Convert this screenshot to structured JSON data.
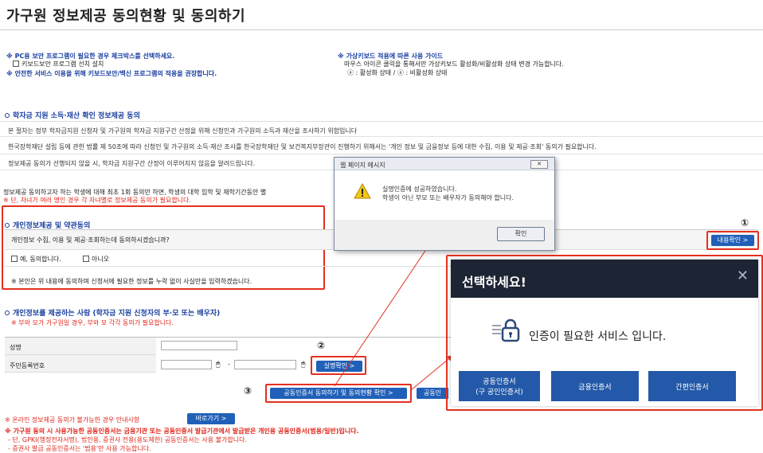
{
  "page_title": "가구원 정보제공 동의현황 및 동의하기",
  "notice_left": {
    "line1": "※ PC용 보안 프로그램이 필요한 경우 체크박스를 선택하세요.",
    "checkbox_label": "키보드보안 프로그램 선치 설치",
    "line3": "※ 안전한 서비스 이용을 위해 키보드보안/백신 프로그램의 적용을 권장합니다."
  },
  "notice_right": {
    "line1": "※ 가상키보드 적용에 따른 사용 가이드",
    "line2": "마우스 아이콘 클릭을 통해서만 가상키보드 활성화/비활성화 상태 변경 가능합니다.",
    "line3": "ⓐ : 활성화 상태 / ⓐ : 비활성화 상태"
  },
  "section1": {
    "title": "학자금 지원 소득·재산 확인 정보제공 동의",
    "rows": [
      "본 절차는 정부 학자금지원 신청자 및 가구원의 학자금 지원구간 산정을 위해 신청인과 가구원의 소득과 재산을 조사하기 위함입니다",
      "한국장학재단 설립 등에 관한 법률 제 50조에 따라 신청인 및 가구원의 소득·재산 조사를 한국장학재단 및 보건복지부장관이 진행하기 위해서는 '개인 정보 및 금융정보 등에 대한 수집, 이용 및 제공·조회' 동의가 필요합니다.",
      "정보제공 동의가 선행되지 않을 시, 학자금 지원구간 산정이 이루어지지 않음을 알려드립니다."
    ],
    "note1": "정보제공 동의하고자 하는 학생에 대해 최초 1회 동의만 하면, 학생의 대학 입학 및 재학기간동안 별",
    "note2": "※ 단, 자녀가 여러 명인 경우 각 자녀별로 정보제공 동의가 필요합니다."
  },
  "section2": {
    "title": "개인정보제공 및 약관동의",
    "question": "개인정보 수집, 이용 및 제공·조회하는데 동의하시겠습니까?",
    "yes_label": "예, 동의합니다.",
    "no_label": "아니오",
    "note": "※ 본인은 위 내용에 동의하며 신청서에 필요한 정보를 누락 없이 사실만을 입력하겠습니다.",
    "view_button": "내용확인 >"
  },
  "section3": {
    "title": "개인정보를 제공하는 사람 (학자금 지원 신청자의 부·모 또는 배우자)",
    "subnote": "※ 부와 모가 가구원일 경우, 부와 모 각각 동의가 필요합니다.",
    "name_label": "성명",
    "rrn_label": "주민등록번호",
    "dash": "-",
    "verify_button": "실명확인 >",
    "cert_consent_button": "공동인증서 동의하기 및 동의현황 확인 >",
    "cert_partial_button": "공동인"
  },
  "bottom": {
    "line1": "※ 온라인 정보제공 동의가 불가능한 경우 안내사항",
    "shortcut_button": "바로가기 >",
    "line2": "※ 가구원 동의 시 사용가능한 공동인증서는 금융기관 또는 공동인증서 발급기관에서 발급받은 개인용 공동인증서(범용/일반)입니다.",
    "line3": "- 단, GPKI(행정전자서명), 법인용, 증권사 전용(용도제한) 공동인증서는 사용 불가합니다.",
    "line4": "- 증권사 발급 공동인증서는 '범용'만 사용 가능합니다."
  },
  "markers": {
    "m1": "①",
    "m2": "②",
    "m3": "③"
  },
  "alert": {
    "title": "웹 페이지 메시지",
    "close": "✕",
    "message1": "실명인증에 성공하였습니다.",
    "message2": "학생이 아닌 부모 또는 배우자가 동의해야 합니다.",
    "ok_button": "확인"
  },
  "modal": {
    "title": "선택하세요!",
    "close": "✕",
    "message": "인증이 필요한 서비스 입니다.",
    "options": [
      {
        "line1": "공동인증서",
        "line2": "(구 공인인증서)"
      },
      {
        "line1": "금융인증서",
        "line2": ""
      },
      {
        "line1": "간편인증서",
        "line2": ""
      }
    ]
  },
  "colors": {
    "accent_blue": "#2060b8",
    "highlight_red": "#e4301f",
    "modal_header": "#1d2433"
  },
  "icons": [
    "lock-icon",
    "warning-icon",
    "close-icon",
    "mouse-icon"
  ]
}
